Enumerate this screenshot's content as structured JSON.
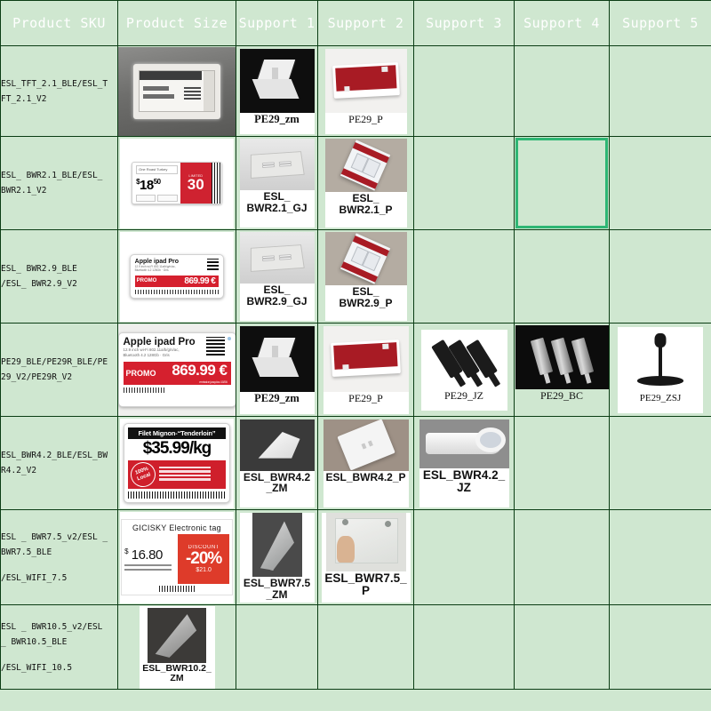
{
  "table": {
    "headers": [
      "Product SKU",
      "Product Size",
      "Support 1",
      "Support 2",
      "Support 3",
      "Support 4",
      "Support 5"
    ],
    "selection": {
      "row": 2,
      "column": "Support 4",
      "color": "#2eb673"
    },
    "theme": {
      "sheet_background": "#cfe7d0",
      "header_background": "#000000",
      "header_text": "#ffffff",
      "gridline": "#0b3d14"
    },
    "rows": [
      {
        "sku_lines": [
          "ESL_TFT_2.1_BLE/ESL_T",
          "FT_2.1_V2"
        ],
        "product_size": {
          "image": "tft-label-photo",
          "caption": ""
        },
        "supports": [
          {
            "image": "pe29-zm-photo",
            "caption": "PE29_zm",
            "style": "serif-bold"
          },
          {
            "image": "pe29-p-photo",
            "caption": "PE29_P",
            "style": "serif"
          },
          null,
          null,
          null
        ]
      },
      {
        "sku_lines": [
          "ESL_ BWR2.1_BLE/ESL_",
          "BWR2.1_V2"
        ],
        "product_size": {
          "image": "esl-price-label-1850-photo",
          "caption": ""
        },
        "supports": [
          {
            "image": "esl-bwr21-gj-photo",
            "caption": "ESL_ BWR2.1_GJ",
            "style": "sans-bold"
          },
          {
            "image": "esl-bwr21-p-photo",
            "caption": "ESL_ BWR2.1_P",
            "style": "sans-bold"
          },
          null,
          null,
          null
        ]
      },
      {
        "sku_lines": [
          "ESL_ BWR2.9_BLE",
          "/ESL_ BWR2.9_V2"
        ],
        "product_size": {
          "image": "apple-ipad-pro-label-photo",
          "caption": ""
        },
        "supports": [
          {
            "image": "esl-bwr29-gj-photo",
            "caption": "ESL_ BWR2.9_GJ",
            "style": "sans-bold"
          },
          {
            "image": "esl-bwr29-p-photo",
            "caption": "ESL_ BWR2.9_P",
            "style": "sans-bold"
          },
          null,
          null,
          null
        ]
      },
      {
        "sku_lines": [
          "PE29_BLE/PE29R_BLE/PE",
          "29_V2/PE29R_V2"
        ],
        "product_size": {
          "image": "apple-ipad-pro-label-large-photo",
          "caption": ""
        },
        "supports": [
          {
            "image": "pe29-zm-photo",
            "caption": "PE29_zm",
            "style": "serif-bold"
          },
          {
            "image": "pe29-p-photo",
            "caption": "PE29_P",
            "style": "serif"
          },
          {
            "image": "pe29-jz-photo",
            "caption": "PE29_JZ",
            "style": "serif"
          },
          {
            "image": "pe29-bc-photo",
            "caption": "PE29_BC",
            "style": "serif"
          },
          {
            "image": "pe29-zsj-photo",
            "caption": "PE29_ZSJ",
            "style": "serif"
          }
        ]
      },
      {
        "sku_lines": [
          "ESL_BWR4.2_BLE/ESL_BW",
          "R4.2_V2"
        ],
        "product_size": {
          "image": "filet-mignon-label-photo",
          "caption": ""
        },
        "supports": [
          {
            "image": "esl-bwr42-zm-photo",
            "caption": "ESL_BWR4.2_ZM",
            "style": "sans-bold"
          },
          {
            "image": "esl-bwr42-p-photo",
            "caption": "ESL_BWR4.2_P",
            "style": "sans-bold"
          },
          {
            "image": "esl-bwr42-jz-photo",
            "caption": "ESL_BWR4.2_JZ",
            "style": "sans-bold-lg"
          },
          null,
          null
        ]
      },
      {
        "sku_lines": [
          "ESL _ BWR7.5_v2/ESL _",
          "BWR7.5_BLE",
          "",
          "/ESL_WIFI_7.5"
        ],
        "product_size": {
          "image": "gicisky-electronic-tag-photo",
          "caption": ""
        },
        "supports": [
          {
            "image": "esl-bwr75-zm-photo",
            "caption": "ESL_BWR7.5_ZM",
            "style": "sans-bold"
          },
          {
            "image": "esl-bwr75-p-photo",
            "caption": "ESL_BWR7.5_P",
            "style": "sans-bold-lg"
          },
          null,
          null,
          null
        ]
      },
      {
        "sku_lines": [
          "ESL _ BWR10.5_v2/ESL",
          "_ BWR10.5_BLE",
          "",
          "/ESL_WIFI_10.5"
        ],
        "product_size": {
          "image": "esl-bwr102-zm-photo",
          "caption": "ESL_BWR10.2_ZM",
          "style": "sans-bold-sm"
        },
        "supports": [
          null,
          null,
          null,
          null,
          null
        ]
      }
    ]
  },
  "photo_text": {
    "tft_label": {
      "title": "电子价签",
      "line1": "名称",
      "line2": "规格型号"
    },
    "price_1850": {
      "name": "One Roast Turkey Breast",
      "price": "18",
      "cents": "50",
      "currency": "$",
      "discount": "30",
      "pct": "%",
      "note": "LIMITED"
    },
    "ipad": {
      "title": "Apple ipad Pro",
      "spec1": "12.9 inch wi‑Fi 802.11a/b/g/n/ac,",
      "spec2": "Bluetooth 4.2    128Gb · Gris",
      "promo": "PROMO",
      "price": "869.99 €",
      "note": "emission jusqu’au 10/06"
    },
    "meat": {
      "title": "Filet Mignon-“Tenderloin”",
      "price": "$35.99/kg",
      "seal": "100% Local"
    },
    "gicisky": {
      "title": "GICISKY Electronic tag",
      "currency": "$",
      "price": "16.80",
      "discount_label": "DISCOUNT",
      "discount": "-20%",
      "old_price": "$21.0",
      "meta1": "Origin:China   Volume:750ml",
      "meta2": "Frequency:50Hz   Size:2(9,8)"
    }
  }
}
